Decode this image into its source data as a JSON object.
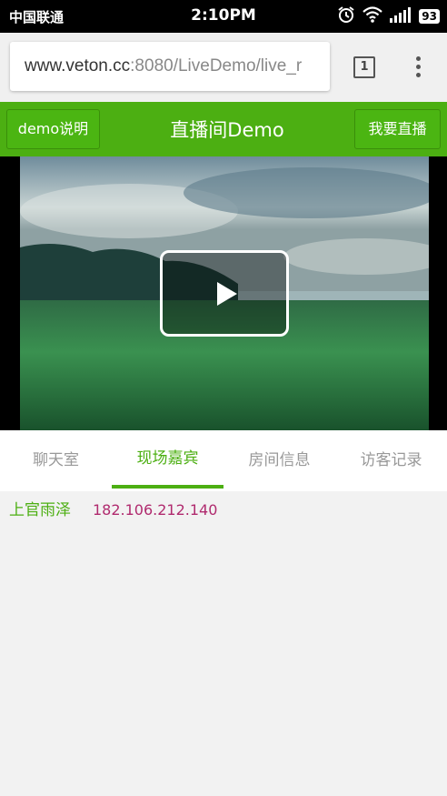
{
  "status_bar": {
    "carrier": "中国联通",
    "time": "2:10PM",
    "battery": "93"
  },
  "browser": {
    "url_host": "www.veton.cc",
    "url_path": ":8080/LiveDemo/live_r",
    "tab_count": "1"
  },
  "header": {
    "left_button": "demo说明",
    "title": "直播间Demo",
    "right_button": "我要直播"
  },
  "tabs": [
    {
      "label": "聊天室"
    },
    {
      "label": "现场嘉宾"
    },
    {
      "label": "房间信息"
    },
    {
      "label": "访客记录"
    }
  ],
  "active_tab": "现场嘉宾",
  "guests": [
    {
      "name": "上官雨泽",
      "ip": "182.106.212.140"
    }
  ],
  "colors": {
    "accent": "#4caf12",
    "ip_text": "#b02a6e"
  },
  "icons": [
    "alarm-icon",
    "wifi-icon",
    "signal-icon",
    "battery-icon",
    "tabs-icon",
    "menu-icon",
    "play-icon"
  ]
}
